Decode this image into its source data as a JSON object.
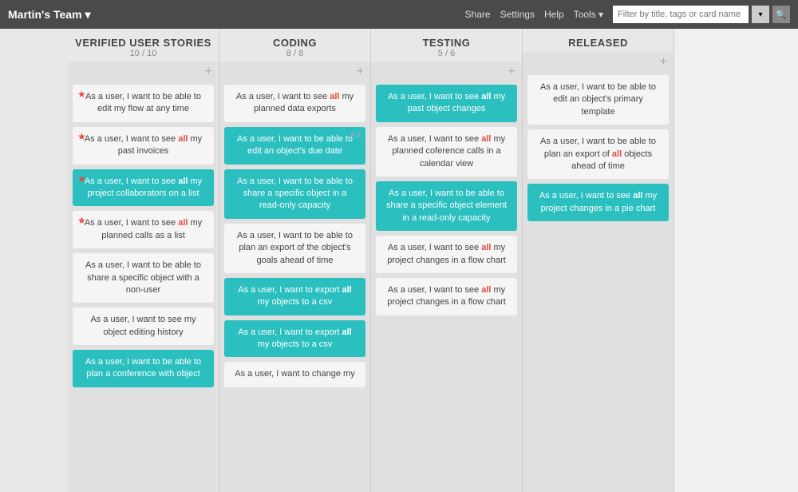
{
  "header": {
    "title": "Martin's Team",
    "dropdown_icon": "▾",
    "nav": [
      "Share",
      "Settings",
      "Help",
      "Tools ▾"
    ],
    "filter_placeholder": "Filter by title, tags or card name",
    "filter_icon": "▾",
    "search_icon": "🔍"
  },
  "columns": [
    {
      "id": "verified",
      "title": "VERIFIED USER STORIES",
      "count": "10 / 10",
      "cards": [
        {
          "id": "v1",
          "text": "As a user, I want to be able to edit my flow at any time",
          "teal": false,
          "star": true,
          "highlight": "all"
        },
        {
          "id": "v2",
          "text": "As a user, I want to see all my past invoices",
          "teal": false,
          "star": true,
          "highlight": "all"
        },
        {
          "id": "v3",
          "text": "As a user, I want to see all my project collaborators on a list",
          "teal": true,
          "star": true,
          "highlight": "all"
        },
        {
          "id": "v4",
          "text": "As a user, I want to see all my planned calls as a list",
          "teal": false,
          "star": true,
          "highlight": "all"
        },
        {
          "id": "v5",
          "text": "As a user, I want to be able to share a specific object with a non-user",
          "teal": false,
          "star": false,
          "highlight": "all"
        },
        {
          "id": "v6",
          "text": "As a user, I want to see my object editing history",
          "teal": false,
          "star": false,
          "highlight": "all"
        },
        {
          "id": "v7",
          "text": "As a user, I want to be able to plan a conference with object",
          "teal": true,
          "star": false,
          "highlight": "all"
        }
      ]
    },
    {
      "id": "coding",
      "title": "CODING",
      "count": "8 / 8",
      "cards": [
        {
          "id": "c1",
          "text": "As a user, I want to see all my planned data exports",
          "teal": false,
          "star": false,
          "highlight": "all"
        },
        {
          "id": "c2",
          "text": "As a user, I want to be able to edit an object's due date",
          "teal": true,
          "star": false,
          "highlight": "all",
          "badge": "AS"
        },
        {
          "id": "c3",
          "text": "As a user, I want to be able to share a specific object in a read-only capacity",
          "teal": true,
          "star": false,
          "highlight": "all"
        },
        {
          "id": "c4",
          "text": "As a user, I want to be able to plan an export of the object's goals ahead of time",
          "teal": false,
          "star": false,
          "highlight": "all"
        },
        {
          "id": "c5",
          "text": "As a user, I want to export all my objects to a csv",
          "teal": true,
          "star": false,
          "highlight": "all"
        },
        {
          "id": "c6",
          "text": "As a user, I want to export all my objects to a csv",
          "teal": true,
          "star": false,
          "highlight": "all"
        },
        {
          "id": "c7",
          "text": "As a user, I want to change my",
          "teal": false,
          "star": false,
          "highlight": "all"
        }
      ]
    },
    {
      "id": "testing",
      "title": "TESTING",
      "count": "5 / 6",
      "cards": [
        {
          "id": "t1",
          "text": "As a user, I want to see all my past object changes",
          "teal": true,
          "star": false,
          "highlight": "all"
        },
        {
          "id": "t2",
          "text": "As a user, I want to see all my planned coference calls in a calendar view",
          "teal": false,
          "star": false,
          "highlight": "all"
        },
        {
          "id": "t3",
          "text": "As a user, I want to be able to share a specific object element in a read-only capacity",
          "teal": true,
          "star": false,
          "highlight": "all"
        },
        {
          "id": "t4",
          "text": "As a user, I want to see all my project changes in a flow chart",
          "teal": false,
          "star": false,
          "highlight": "all"
        },
        {
          "id": "t5",
          "text": "As a user, I want to see all my project changes in a flow chart",
          "teal": false,
          "star": false,
          "highlight": "all"
        }
      ]
    },
    {
      "id": "released",
      "title": "RELEASED",
      "count": "",
      "cards": [
        {
          "id": "r1",
          "text": "As a user, I want to be able to edit an object's primary template",
          "teal": false,
          "star": false,
          "highlight": "all"
        },
        {
          "id": "r2",
          "text": "As a user, I want to be able to plan an export of all objects ahead of time",
          "teal": false,
          "star": false,
          "highlight": "all"
        },
        {
          "id": "r3",
          "text": "As a user, I want to see all my project changes in a pie chart",
          "teal": true,
          "star": false,
          "highlight": "all"
        }
      ]
    }
  ]
}
